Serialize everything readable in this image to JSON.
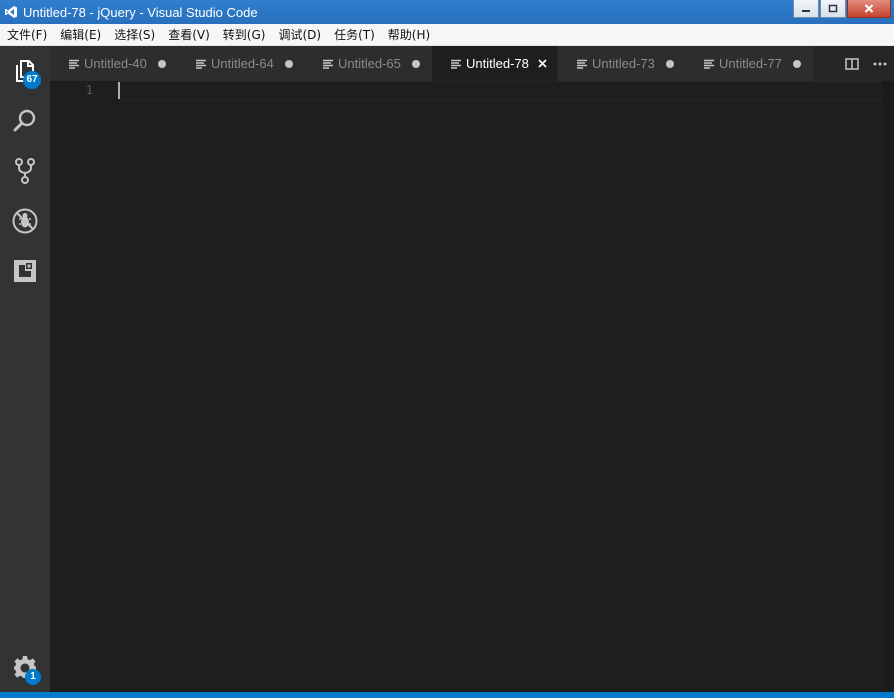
{
  "window": {
    "title": "Untitled-78 - jQuery - Visual Studio Code"
  },
  "menu": {
    "items": [
      {
        "label": "文件(F)"
      },
      {
        "label": "编辑(E)"
      },
      {
        "label": "选择(S)"
      },
      {
        "label": "查看(V)"
      },
      {
        "label": "转到(G)"
      },
      {
        "label": "调试(D)"
      },
      {
        "label": "任务(T)"
      },
      {
        "label": "帮助(H)"
      }
    ]
  },
  "activity_bar": {
    "explorer_badge": "67",
    "settings_badge": "1",
    "icons": [
      "files-icon",
      "search-icon",
      "source-control-icon",
      "debug-icon",
      "extensions-icon",
      "gear-icon"
    ]
  },
  "tabs": [
    {
      "label": "Untitled-40",
      "active": false,
      "dirty": true
    },
    {
      "label": "Untitled-64",
      "active": false,
      "dirty": true
    },
    {
      "label": "Untitled-65",
      "active": false,
      "dirty": true
    },
    {
      "label": "Untitled-78",
      "active": true,
      "dirty": false
    },
    {
      "label": "Untitled-73",
      "active": false,
      "dirty": true
    },
    {
      "label": "Untitled-77",
      "active": false,
      "dirty": true
    }
  ],
  "editor": {
    "line_numbers": [
      "1"
    ]
  },
  "colors": {
    "title_bar": "#2870be",
    "activity_bar": "#333333",
    "editor_bg": "#1e1e1e",
    "status_bar": "#007acc",
    "badge": "#007acc"
  }
}
